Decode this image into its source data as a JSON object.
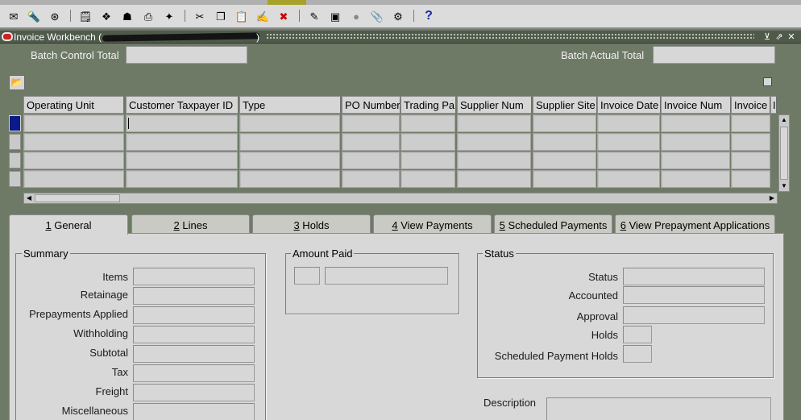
{
  "toolbar": {
    "icons": [
      "new-icon",
      "find-icon",
      "navigator-icon",
      "save-icon",
      "next-step-icon",
      "switch-responsibility-icon",
      "print-icon",
      "close-form-icon",
      "cut-icon",
      "copy-icon",
      "paste-icon",
      "new-record-icon",
      "delete-record-icon",
      "edit-field-icon",
      "zoom-icon",
      "translations-icon",
      "attachments-icon",
      "folder-tools-icon",
      "help-icon"
    ],
    "help_glyph": "?"
  },
  "window": {
    "title": "Invoice Workbench ("
  },
  "header": {
    "batch_control_total_label": "Batch Control Total",
    "batch_control_total_value": "",
    "batch_actual_total_label": "Batch Actual Total",
    "batch_actual_total_value": ""
  },
  "grid": {
    "columns": [
      "Operating Unit",
      "Customer Taxpayer ID",
      "Type",
      "PO Number",
      "Trading Pa",
      "Supplier Num",
      "Supplier Site",
      "Invoice Date",
      "Invoice Num",
      "Invoice",
      "I"
    ],
    "rows": [
      [
        "",
        "",
        "",
        "",
        "",
        "",
        "",
        "",
        "",
        ""
      ],
      [
        "",
        "",
        "",
        "",
        "",
        "",
        "",
        "",
        "",
        ""
      ],
      [
        "",
        "",
        "",
        "",
        "",
        "",
        "",
        "",
        "",
        ""
      ],
      [
        "",
        "",
        "",
        "",
        "",
        "",
        "",
        "",
        "",
        ""
      ]
    ]
  },
  "tabs": [
    "1 General",
    "2 Lines",
    "3 Holds",
    "4 View Payments",
    "5 Scheduled Payments",
    "6 View Prepayment Applications"
  ],
  "summary": {
    "title": "Summary",
    "fields": [
      "Items",
      "Retainage",
      "Prepayments Applied",
      "Withholding",
      "Subtotal",
      "Tax",
      "Freight",
      "Miscellaneous"
    ]
  },
  "amount_paid": {
    "title": "Amount Paid",
    "currency": "",
    "value": ""
  },
  "status": {
    "title": "Status",
    "fields": [
      "Status",
      "Accounted",
      "Approval",
      "Holds",
      "Scheduled Payment Holds"
    ]
  },
  "description": {
    "label": "Description",
    "value": ""
  },
  "colors": {
    "background": "#6e7a66",
    "titlebar": "#4f5a4a",
    "field": "#d7d7d7",
    "active_row": "#0a1a8a"
  }
}
